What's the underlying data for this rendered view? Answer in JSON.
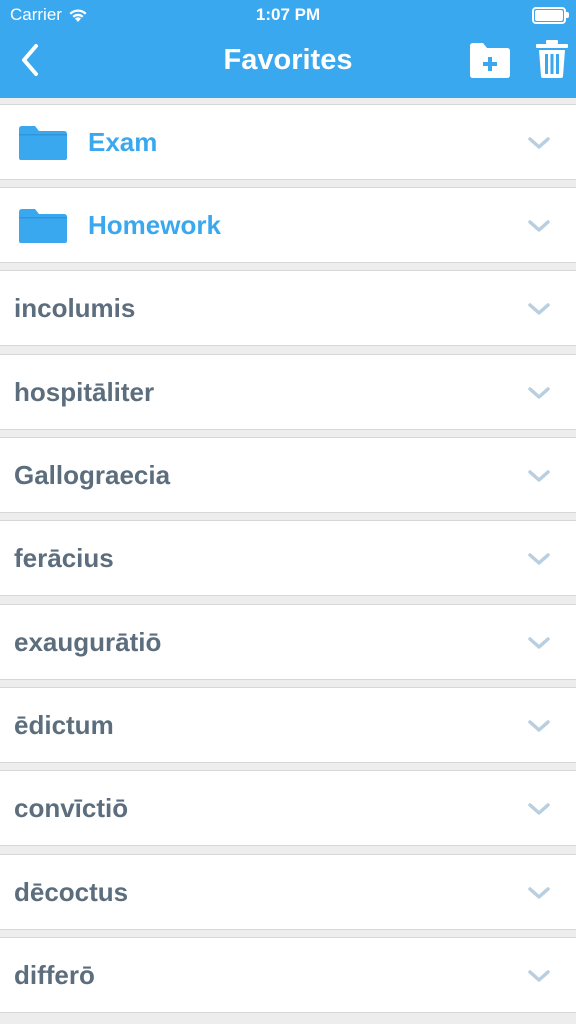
{
  "status_bar": {
    "carrier": "Carrier",
    "time": "1:07 PM"
  },
  "nav": {
    "title": "Favorites",
    "back_icon": "chevron-left-icon",
    "new_folder_icon": "folder-plus-icon",
    "trash_icon": "trash-icon"
  },
  "folders": [
    {
      "label": "Exam"
    },
    {
      "label": "Homework"
    }
  ],
  "words": [
    {
      "label": "incolumis"
    },
    {
      "label": "hospitāliter"
    },
    {
      "label": "Gallograecia"
    },
    {
      "label": "ferācius"
    },
    {
      "label": "exaugurātiō"
    },
    {
      "label": "ēdictum"
    },
    {
      "label": "convīctiō"
    },
    {
      "label": "dēcoctus"
    },
    {
      "label": "differō"
    }
  ],
  "colors": {
    "accent": "#3aa8ef",
    "word_text": "#5c6e7d",
    "chevron": "#b9cfe0",
    "background": "#ededed"
  }
}
